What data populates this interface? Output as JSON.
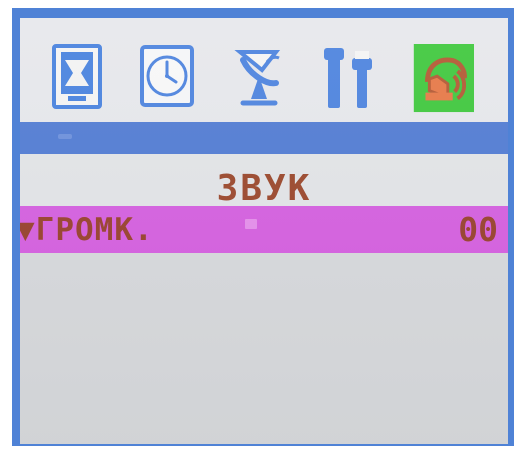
{
  "screen": {
    "colors": {
      "frame": "#4f82d6",
      "panel": "#e3e5e8",
      "separator": "#547ed4",
      "highlight_row": "#d662e1",
      "text": "#9a4430",
      "selected_icon": "#42c940"
    }
  },
  "menu_icons": [
    {
      "name": "picture-menu-icon",
      "selected": false,
      "color": "#5188e0"
    },
    {
      "name": "clock-menu-icon",
      "selected": false,
      "color": "#5188e0"
    },
    {
      "name": "satellite-dish-menu-icon",
      "selected": false,
      "color": "#5188e0"
    },
    {
      "name": "tools-menu-icon",
      "selected": false,
      "color": "#5188e0"
    },
    {
      "name": "sound-menu-icon",
      "selected": true,
      "color": "#b55a36"
    }
  ],
  "menu": {
    "title": "ЗВУК",
    "row": {
      "marker": "▼",
      "label": "ГРОМК.",
      "value": "00"
    }
  }
}
